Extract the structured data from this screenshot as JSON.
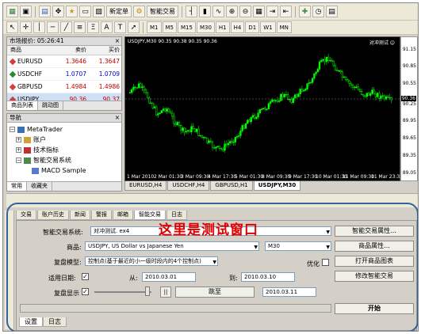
{
  "toolbar": {
    "new_order": "新定单",
    "expert": "智能交易",
    "timeframes": [
      "M1",
      "M5",
      "M15",
      "M30",
      "H1",
      "H4",
      "D1",
      "W1",
      "MN"
    ]
  },
  "market_watch": {
    "title": "市场报价: 05:26:41",
    "columns": [
      "商品",
      "卖价",
      "买价"
    ],
    "rows": [
      {
        "symbol": "EURUSD",
        "bid": "1.3646",
        "ask": "1.3647",
        "color": "#d04040"
      },
      {
        "symbol": "USDCHF",
        "bid": "1.0707",
        "ask": "1.0709",
        "color": "#2a8a2a"
      },
      {
        "symbol": "GBPUSD",
        "bid": "1.4984",
        "ask": "1.4986",
        "color": "#d04040"
      },
      {
        "symbol": "USDJPY",
        "bid": "90.36",
        "ask": "90.37",
        "color": "#d04040"
      }
    ],
    "tabs": [
      "商品列表",
      "跳动图"
    ]
  },
  "navigator": {
    "title": "导航",
    "root": "MetaTrader",
    "items": [
      "账户",
      "技术指标",
      "智能交易系统",
      "MACD Sample"
    ],
    "tabs": [
      "常用",
      "收藏夹"
    ]
  },
  "chart": {
    "info": "USDJPY,M30  90.35 90.38 90.35 90.36",
    "corner": "对冲测试 ☺",
    "y_labels": [
      "91.15",
      "90.85",
      "90.55",
      "90.36",
      "90.25",
      "89.95",
      "89.65",
      "89.35",
      "89.05"
    ],
    "x_labels": [
      "1 Mar 2010",
      "2 Mar 01:30",
      "3 Mar 09:30",
      "4 Mar 17:30",
      "5 Mar 01:30",
      "8 Mar 09:30",
      "9 Mar 17:30",
      "10 Mar 01:30",
      "11 Mar 09:30",
      "11 Mar 23:33"
    ],
    "tabs": [
      "EURUSD,H4",
      "USDCHF,H4",
      "GBPUSD,H1",
      "USDJPY,M30"
    ]
  },
  "terminal_tabs": [
    "交易",
    "账户历史",
    "新闻",
    "警报",
    "邮箱",
    "智能交易",
    "日志"
  ],
  "tester": {
    "ea_label": "智能交易系统:",
    "ea_value": "对冲测试. ex4",
    "ea_props": "智能交易属性...",
    "symbol_label": "商品:",
    "symbol_value": "USDJPY, US Dollar vs Japanese Yen",
    "period_value": "M30",
    "symbol_props": "商品属性...",
    "model_label": "复盘模型:",
    "model_value": "控制点(基于最近的小一级时段内的4个控制点)",
    "optimize": "优化",
    "open_chart": "打开商品图表",
    "date_label": "适用日期:",
    "from_label": "从:",
    "from_value": "2010.03.01",
    "to_label": "到:",
    "to_value": "2010.03.10",
    "modify_ea": "修改智能交易",
    "visual_label": "复盘显示",
    "skip_to": "跳至",
    "skip_date": "2010.03.11",
    "start": "开始",
    "bottom_tabs": [
      "设置",
      "日志"
    ]
  },
  "annotation": "这里是测试窗口"
}
